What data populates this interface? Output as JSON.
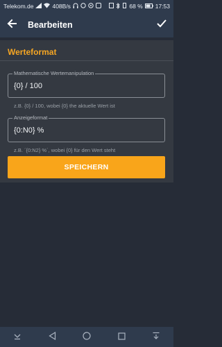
{
  "status_bar": {
    "carrier": "Telekom.de",
    "speed": "408B/s",
    "battery": "68 %",
    "time": "17:53"
  },
  "app_bar": {
    "title": "Bearbeiten",
    "back_icon": "arrow-left-icon",
    "done_icon": "check-icon"
  },
  "section": {
    "title": "Werteformat"
  },
  "fields": {
    "manipulation": {
      "label": "Mathematische Wertemanipulation",
      "value": "{0} / 100",
      "helper": "z.B. {0} / 100, wobei {0} the aktuelle Wert ist"
    },
    "format": {
      "label": "Anzeigeformat",
      "value": "{0:N0} %",
      "helper": "z.B. ´{0:N2} %´, wobei {0} für den Wert steht"
    }
  },
  "save_button": {
    "label": "SPEICHERN"
  },
  "colors": {
    "accent": "#f9a51a",
    "app_bar": "#2f3b4d",
    "background": "#262c37",
    "card": "#343941"
  }
}
